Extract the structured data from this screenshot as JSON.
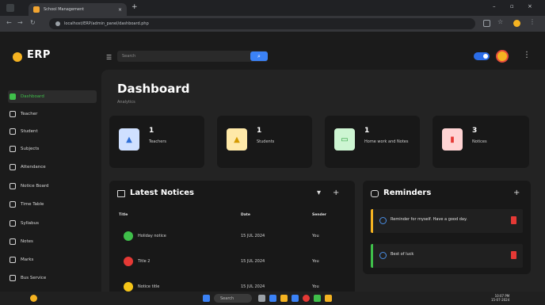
{
  "browser": {
    "tab_title": "School Management",
    "url": "localhost/ERP/admin_panel/dashboard.php"
  },
  "app": {
    "logo": "ERP",
    "search_placeholder": "Search",
    "accent": "#3fbf4a"
  },
  "sidebar": {
    "items": [
      {
        "label": "Dashboard",
        "icon": "dashboard-icon"
      },
      {
        "label": "Teacher",
        "icon": "teacher-icon"
      },
      {
        "label": "Student",
        "icon": "student-icon"
      },
      {
        "label": "Subjects",
        "icon": "subjects-icon"
      },
      {
        "label": "Attendance",
        "icon": "attendance-icon"
      },
      {
        "label": "Notice Board",
        "icon": "notice-board-icon"
      },
      {
        "label": "Time Table",
        "icon": "timetable-icon"
      },
      {
        "label": "Syllabus",
        "icon": "syllabus-icon"
      },
      {
        "label": "Notes",
        "icon": "notes-icon"
      },
      {
        "label": "Marks",
        "icon": "marks-icon"
      },
      {
        "label": "Bus Service",
        "icon": "bus-icon"
      }
    ]
  },
  "main": {
    "title": "Dashboard",
    "breadcrumb": "Analytics",
    "stats": [
      {
        "value": "1",
        "label": "Teachers",
        "color": "#cfe0ff"
      },
      {
        "value": "1",
        "label": "Students",
        "color": "#ffe9a8"
      },
      {
        "value": "1",
        "label": "Home work and Notes",
        "color": "#cdf5d2"
      },
      {
        "value": "3",
        "label": "Notices",
        "color": "#ffd3d3"
      }
    ],
    "notices": {
      "title": "Latest Notices",
      "columns": [
        "Title",
        "Date",
        "Sender"
      ],
      "rows": [
        {
          "title": "Holiday notice",
          "date": "15 JUL 2024",
          "sender": "You",
          "color": "#3fbf4a"
        },
        {
          "title": "Title 2",
          "date": "15 JUL 2024",
          "sender": "You",
          "color": "#e53935"
        },
        {
          "title": "Notice title",
          "date": "15 JUL 2024",
          "sender": "You",
          "color": "#f5c518"
        }
      ]
    },
    "reminders": {
      "title": "Reminders",
      "items": [
        {
          "text": "Reminder for myself. Have a good day.",
          "color": "#f5b321"
        },
        {
          "text": "Best of luck",
          "color": "#3fbf4a"
        }
      ]
    }
  },
  "taskbar": {
    "search_label": "Search",
    "time": "10:07 PM",
    "date": "15-07-2024"
  }
}
